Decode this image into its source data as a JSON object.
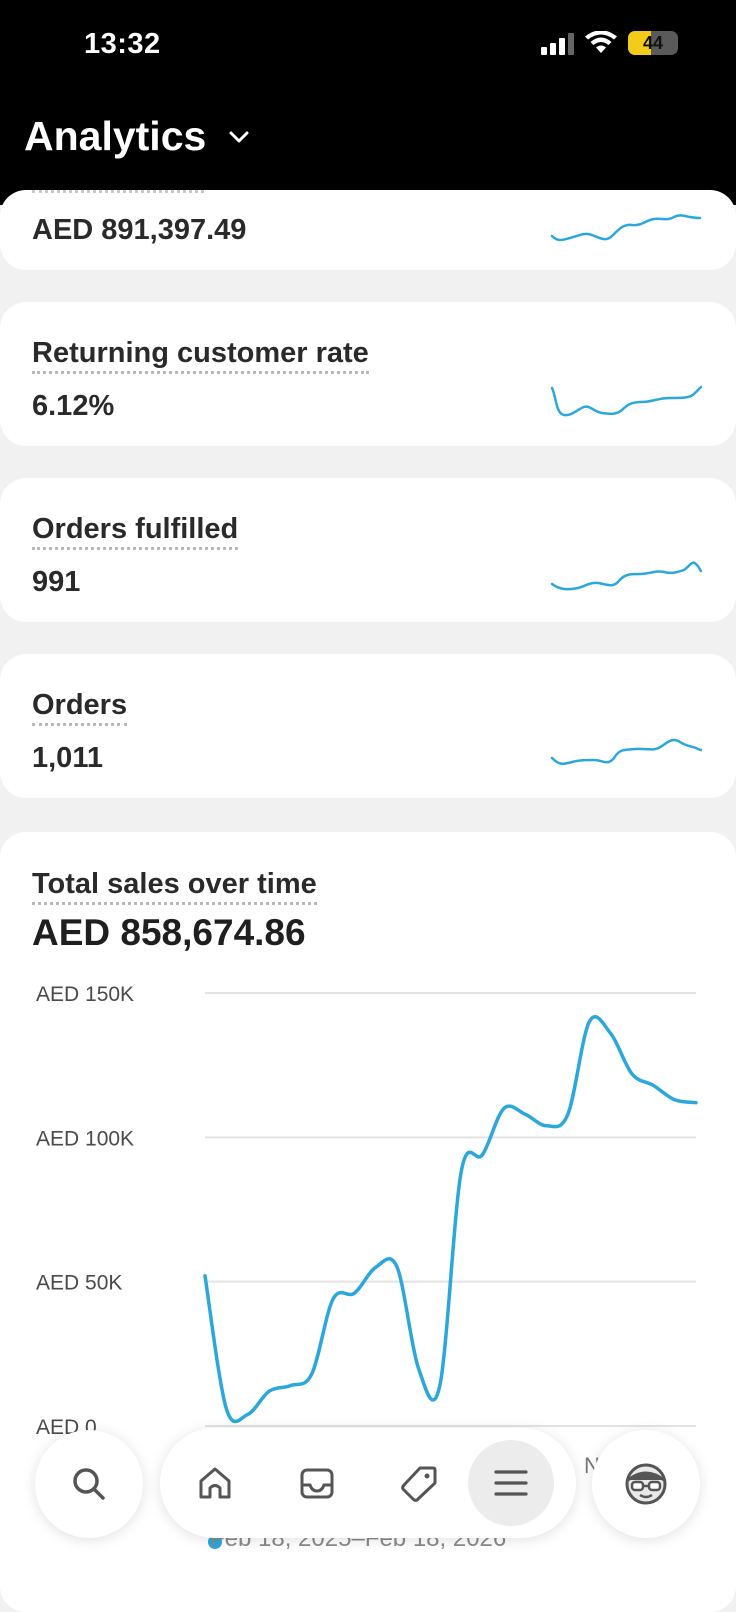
{
  "status_bar": {
    "time": "13:32",
    "battery": "44"
  },
  "header": {
    "title": "Analytics"
  },
  "metrics": [
    {
      "label": "",
      "value": "AED 891,397.49"
    },
    {
      "label": "Returning customer rate",
      "value": "6.12%"
    },
    {
      "label": "Orders fulfilled",
      "value": "991"
    },
    {
      "label": "Orders",
      "value": "1,011"
    }
  ],
  "chart": {
    "title": "Total sales over time",
    "total": "AED 858,674.86",
    "legend_date": "Feb 18, 2025–Feb 18, 2026",
    "peek_label": "N"
  },
  "chart_data": {
    "type": "line",
    "title": "Total sales over time",
    "ylabel": "",
    "y_ticks": [
      "AED 150K",
      "AED 100K",
      "AED 50K",
      "AED 0"
    ],
    "ylim": [
      0,
      150000
    ],
    "grid": true,
    "series": [
      {
        "values": [
          52000,
          6000,
          4000,
          12000,
          14000,
          18000,
          44000,
          46000,
          55000,
          55000,
          20000,
          14000,
          88000,
          94000,
          110000,
          108000,
          104000,
          108000,
          140000,
          136000,
          122000,
          118000,
          113000,
          112000
        ]
      }
    ],
    "color": "#2ba7dd"
  },
  "nav": {
    "items": [
      "search-icon",
      "home-icon",
      "inbox-icon",
      "tag-icon",
      "menu-icon",
      "avatar-icon"
    ],
    "active": "menu-icon"
  }
}
